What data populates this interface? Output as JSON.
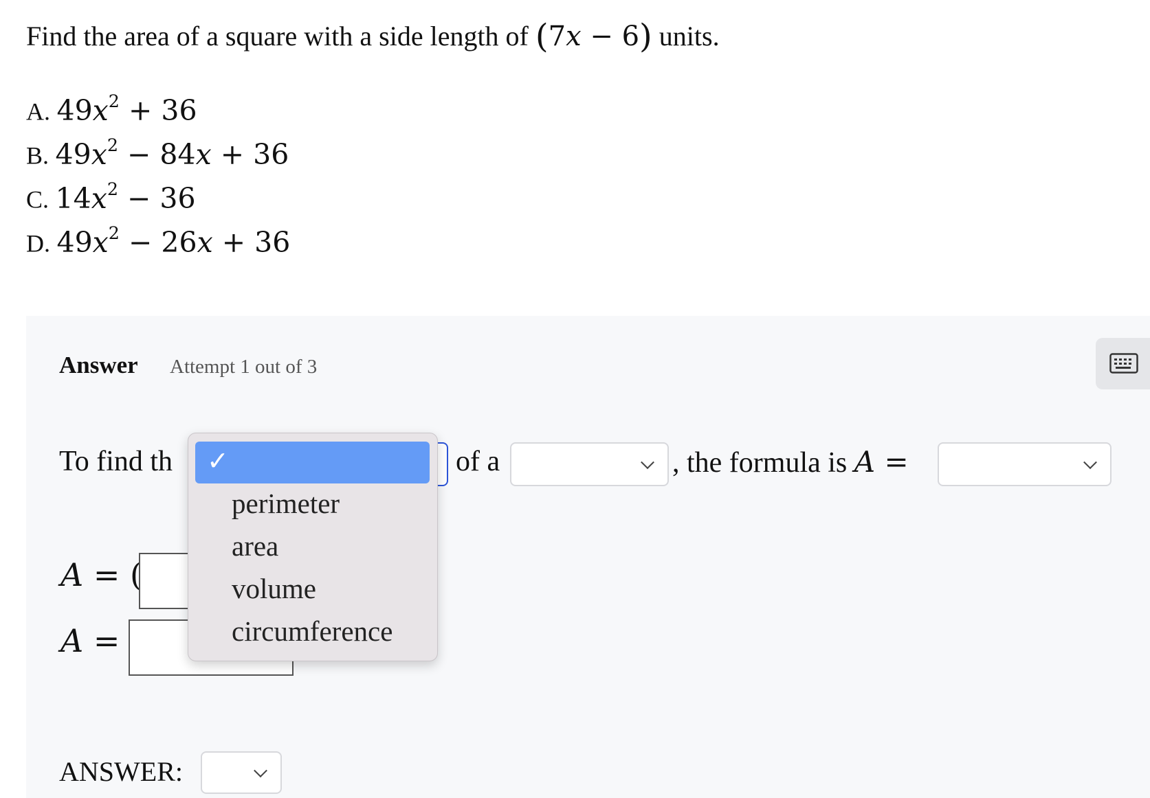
{
  "question": {
    "prefix": "Find the area of a square with a side length of ",
    "open_paren": "(",
    "coef": "7",
    "var": "x",
    "minus": " − 6",
    "close_paren": ")",
    "suffix": " units."
  },
  "choices": [
    {
      "letter": "A.",
      "pre": "49",
      "var": "x",
      "sup": "2",
      "post": " + 36"
    },
    {
      "letter": "B.",
      "pre": "49",
      "var": "x",
      "sup": "2",
      "mid": " − 84",
      "var2": "x",
      "post": " + 36"
    },
    {
      "letter": "C.",
      "pre": "14",
      "var": "x",
      "sup": "2",
      "post": " − 36"
    },
    {
      "letter": "D.",
      "pre": "49",
      "var": "x",
      "sup": "2",
      "mid": " − 26",
      "var2": "x",
      "post": " + 36"
    }
  ],
  "answer_section": {
    "label": "Answer",
    "attempt": "Attempt 1 out of 3",
    "keyboard_icon": "keyboard-icon"
  },
  "sentence": {
    "part1": "To find th",
    "part2": "of a",
    "part3": ", the formula is ",
    "formula_var": "A",
    "equals": " ="
  },
  "equations": {
    "eq1_lhs": "A",
    "eq1_op": " = (",
    "eq2_lhs": "A",
    "eq2_op": " ="
  },
  "final": {
    "label": "ANSWER:"
  },
  "dropdown": {
    "selected_check": "✓",
    "options": [
      "perimeter",
      "area",
      "volume",
      "circumference"
    ]
  },
  "colors": {
    "highlight": "#649bf6",
    "focus_border": "#2d55d8",
    "panel_bg": "#f7f8fa"
  }
}
